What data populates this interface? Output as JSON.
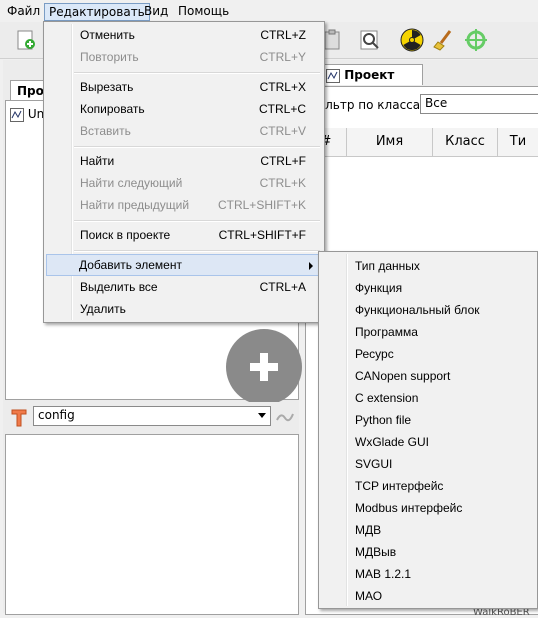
{
  "menubar": {
    "items": [
      "Файл",
      "Редактировать",
      "Вид",
      "Помощь"
    ]
  },
  "left_panel": {
    "tab_label": "Проект",
    "tree_item": "Un",
    "config_select": "config"
  },
  "right_panel": {
    "tab_label": "Проект",
    "filter_label": "Фильтр по классам:",
    "filter_value": "Все",
    "columns": [
      "#",
      "Имя",
      "Класс",
      "Ти"
    ],
    "bottom_text": "WalkRoBER"
  },
  "edit_menu": {
    "items": [
      {
        "label": "Отменить",
        "accel": "CTRL+Z",
        "disabled": false
      },
      {
        "label": "Повторить",
        "accel": "CTRL+Y",
        "disabled": true
      },
      {
        "label": "Вырезать",
        "accel": "CTRL+X",
        "disabled": false
      },
      {
        "label": "Копировать",
        "accel": "CTRL+C",
        "disabled": false
      },
      {
        "label": "Вставить",
        "accel": "CTRL+V",
        "disabled": true
      },
      {
        "label": "Найти",
        "accel": "CTRL+F",
        "disabled": false
      },
      {
        "label": "Найти следующий",
        "accel": "CTRL+K",
        "disabled": true
      },
      {
        "label": "Найти предыдущий",
        "accel": "CTRL+SHIFT+K",
        "disabled": true
      },
      {
        "label": "Поиск в проекте",
        "accel": "CTRL+SHIFT+F",
        "disabled": false
      },
      {
        "label": "Добавить элемент",
        "accel": "",
        "disabled": false
      },
      {
        "label": "Выделить все",
        "accel": "CTRL+A",
        "disabled": false
      },
      {
        "label": "Удалить",
        "accel": "",
        "disabled": false
      }
    ]
  },
  "add_submenu": {
    "items": [
      "Тип данных",
      "Функция",
      "Функциональный блок",
      "Программа",
      "Ресурс",
      "CANopen support",
      "C extension",
      "Python file",
      "WxGlade GUI",
      "SVGUI",
      "TCP интерфейс",
      "Modbus интерфейс",
      "МДВ",
      "МДВыв",
      "МАВ 1.2.1",
      "МАО"
    ]
  },
  "colors": {
    "highlight": "#dde7f5",
    "disabled_text": "#8d8d8d",
    "menu_bg": "#f1f1f1"
  }
}
